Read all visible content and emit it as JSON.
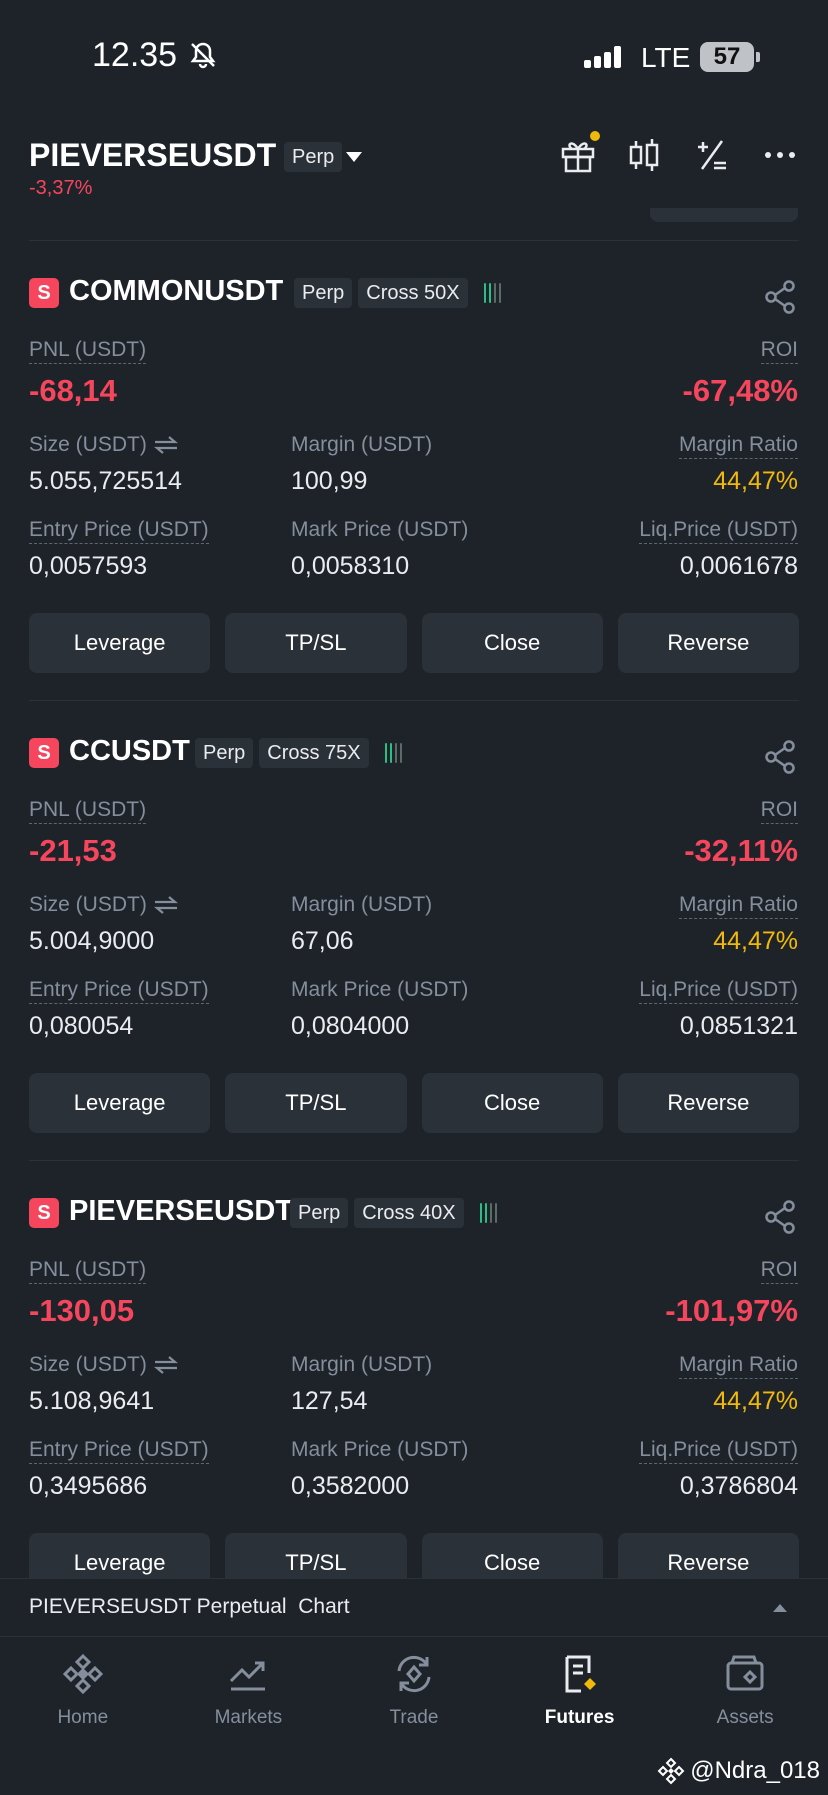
{
  "status_bar": {
    "time": "12.35",
    "network": "LTE",
    "battery": "57"
  },
  "header": {
    "symbol": "PIEVERSEUSDT",
    "tag": "Perp",
    "change": "-3,37%"
  },
  "colors": {
    "bg": "#1e2329",
    "card": "#2b3139",
    "red": "#f6465d",
    "green": "#2ebd85",
    "yellow": "#f0b90b",
    "muted": "#848e9c"
  },
  "labels": {
    "pnl": "PNL (USDT)",
    "roi": "ROI",
    "size": "Size (USDT)",
    "margin": "Margin (USDT)",
    "margin_ratio": "Margin Ratio",
    "entry": "Entry Price (USDT)",
    "mark": "Mark Price (USDT)",
    "liq": "Liq.Price (USDT)"
  },
  "buttons": {
    "leverage": "Leverage",
    "tpsl": "TP/SL",
    "close": "Close",
    "reverse": "Reverse"
  },
  "positions": [
    {
      "side": "S",
      "symbol": "COMMONUSDT",
      "type": "Perp",
      "mode": "Cross 50X",
      "pnl": "-68,14",
      "roi": "-67,48%",
      "size": "5.055,725514",
      "margin": "100,99",
      "margin_ratio": "44,47%",
      "entry": "0,0057593",
      "mark": "0,0058310",
      "liq": "0,0061678"
    },
    {
      "side": "S",
      "symbol": "CCUSDT",
      "type": "Perp",
      "mode": "Cross 75X",
      "pnl": "-21,53",
      "roi": "-32,11%",
      "size": "5.004,9000",
      "margin": "67,06",
      "margin_ratio": "44,47%",
      "entry": "0,080054",
      "mark": "0,0804000",
      "liq": "0,0851321"
    },
    {
      "side": "S",
      "symbol": "PIEVERSEUSDT",
      "type": "Perp",
      "mode": "Cross 40X",
      "pnl": "-130,05",
      "roi": "-101,97%",
      "size": "5.108,9641",
      "margin": "127,54",
      "margin_ratio": "44,47%",
      "entry": "0,3495686",
      "mark": "0,3582000",
      "liq": "0,3786804"
    }
  ],
  "chart_bar": {
    "text": "PIEVERSEUSDT Perpetual  Chart"
  },
  "nav": [
    {
      "label": "Home",
      "icon": "home-icon"
    },
    {
      "label": "Markets",
      "icon": "markets-icon"
    },
    {
      "label": "Trade",
      "icon": "trade-icon"
    },
    {
      "label": "Futures",
      "icon": "futures-icon"
    },
    {
      "label": "Assets",
      "icon": "assets-icon"
    }
  ],
  "watermark": "@Ndra_018"
}
